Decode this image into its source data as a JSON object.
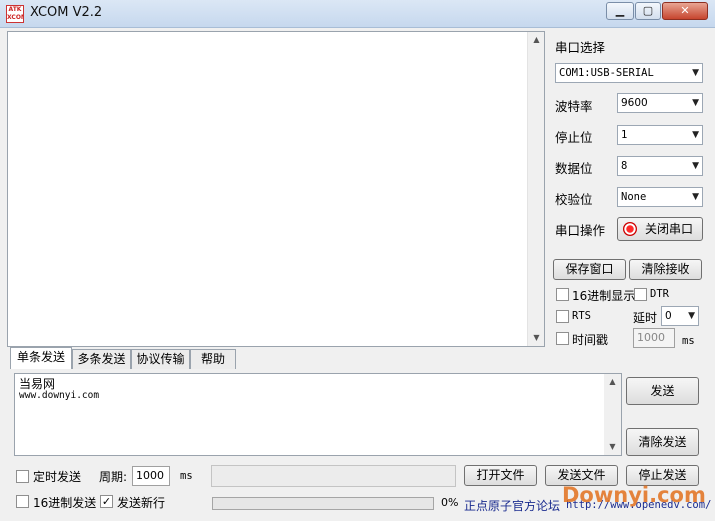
{
  "window": {
    "logo_text": "ATK XCOM",
    "title": "XCOM V2.2"
  },
  "right_panel": {
    "port_select_label": "串口选择",
    "port_value": "COM1:USB-SERIAL",
    "baud_label": "波特率",
    "baud_value": "9600",
    "stop_label": "停止位",
    "stop_value": "1",
    "data_label": "数据位",
    "data_value": "8",
    "parity_label": "校验位",
    "parity_value": "None",
    "port_op_label": "串口操作",
    "close_port_button": "关闭串口",
    "save_window_button": "保存窗口",
    "clear_receive_button": "清除接收",
    "hex_display_label": "16进制显示",
    "dtr_label": "DTR",
    "rts_label": "RTS",
    "delay_label": "延时",
    "delay_value": "0",
    "timestamp_label": "时间戳",
    "timestamp_value": "1000",
    "ms_label": "ms"
  },
  "tabs": [
    "单条发送",
    "多条发送",
    "协议传输",
    "帮助"
  ],
  "send": {
    "text_line1": "当易网",
    "text_line2": "www.downyi.com",
    "send_button": "发送",
    "clear_send_button": "清除发送"
  },
  "bottom": {
    "timed_send_label": "定时发送",
    "period_label": "周期:",
    "period_value": "1000",
    "ms_label": "ms",
    "open_file_button": "打开文件",
    "send_file_button": "发送文件",
    "stop_send_button": "停止发送",
    "hex_send_label": "16进制发送",
    "send_newline_label": "发送新行",
    "progress_text": "0%",
    "progress_value": 0,
    "forum_link": "正点原子官方论坛",
    "forum_url": "http://www.openedv.com/",
    "watermark": "Downyi.com"
  },
  "icons": {
    "dropdown": "chevron-down-icon",
    "close_port": "red-record-icon"
  }
}
